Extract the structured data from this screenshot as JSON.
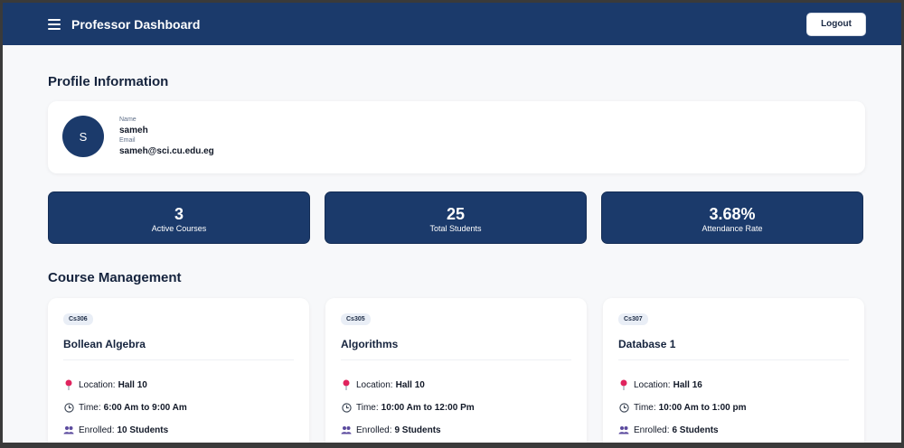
{
  "header": {
    "title": "Professor Dashboard",
    "logout_label": "Logout"
  },
  "profile": {
    "section_title": "Profile Information",
    "avatar_initial": "S",
    "name_label": "Name",
    "name": "sameh",
    "email_label": "Email",
    "email": "sameh@sci.cu.edu.eg"
  },
  "stats": [
    {
      "value": "3",
      "label": "Active Courses"
    },
    {
      "value": "25",
      "label": "Total Students"
    },
    {
      "value": "3.68%",
      "label": "Attendance Rate"
    }
  ],
  "courses": {
    "section_title": "Course Management",
    "items": [
      {
        "code": "Cs306",
        "name": "Bollean Algebra",
        "location_label": "Location:",
        "location": "Hall 10",
        "time_label": "Time:",
        "time": "6:00 Am to 9:00 Am",
        "enrolled_label": "Enrolled:",
        "enrolled": "10 Students"
      },
      {
        "code": "Cs305",
        "name": "Algorithms",
        "location_label": "Location:",
        "location": "Hall 10",
        "time_label": "Time:",
        "time": "10:00 Am to 12:00 Pm",
        "enrolled_label": "Enrolled:",
        "enrolled": "9 Students"
      },
      {
        "code": "Cs307",
        "name": "Database 1",
        "location_label": "Location:",
        "location": "Hall 16",
        "time_label": "Time:",
        "time": "10:00 Am to 1:00 pm",
        "enrolled_label": "Enrolled:",
        "enrolled": "6 Students"
      }
    ]
  },
  "icons": {
    "menu": "hamburger-menu-icon",
    "location": "pin-icon",
    "time": "clock-icon",
    "enrolled": "people-icon"
  },
  "colors": {
    "primary": "#1b3a6b",
    "background": "#f7f8fa",
    "card": "#ffffff",
    "pin": "#e0245e"
  }
}
